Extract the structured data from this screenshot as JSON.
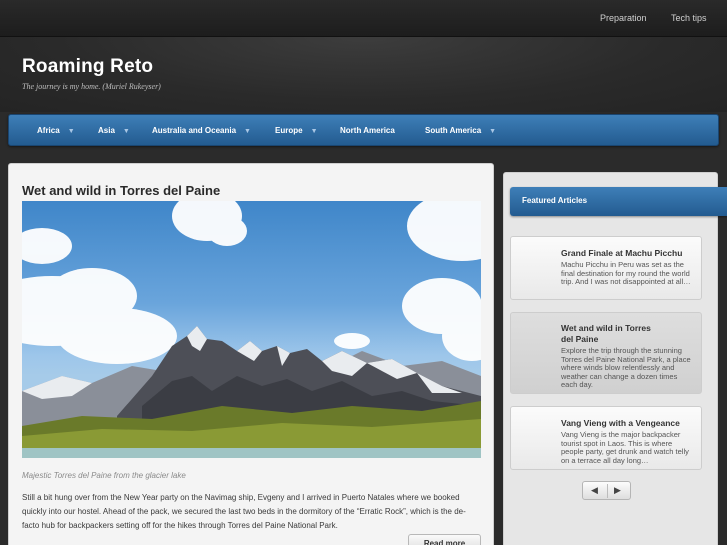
{
  "topnav": {
    "items": [
      {
        "label": "Preparation"
      },
      {
        "label": "Tech tips"
      }
    ]
  },
  "site": {
    "title": "Roaming Reto",
    "tagline": "The journey is my home. (Muriel Rukeyser)"
  },
  "mainnav": {
    "items": [
      {
        "label": "Africa",
        "has_dropdown": true
      },
      {
        "label": "Asia",
        "has_dropdown": true
      },
      {
        "label": "Australia and Oceania",
        "has_dropdown": true
      },
      {
        "label": "Europe",
        "has_dropdown": true
      },
      {
        "label": "North America",
        "has_dropdown": false
      },
      {
        "label": "South America",
        "has_dropdown": true
      }
    ],
    "chevron_icon": "chevron-down-icon"
  },
  "post": {
    "title": "Wet and wild in Torres del Paine",
    "caption": "Majestic Torres del Paine from the glacier lake",
    "excerpt": "Still a bit hung over from the New Year party on the Navimag ship, Evgeny and I arrived in Puerto Natales where we booked quickly into our hostel. Ahead of the pack, we secured the last two beds in the dormitory of the “Erratic Rock”, which is the de-facto hub for backpackers setting off for the hikes through Torres del Paine National Park.",
    "read_more": "Read more"
  },
  "sidebar": {
    "title": "Featured Articles",
    "articles": [
      {
        "title": "Grand Finale at Machu Picchu",
        "text": "Machu Picchu in Peru was set as the final destination for my round the world trip. And I was not disappointed at all…",
        "active": false
      },
      {
        "title": "Wet and wild in Torres del Paine",
        "text": "Explore the trip through the stunning Torres del Paine National Park, a place where winds blow relentlessly and weather can change a dozen times each day.",
        "active": true
      },
      {
        "title": "Vang Vieng with a Vengeance",
        "text": "Vang Vieng is the major backpacker tourist spot in Laos. This is where people party, get drunk and watch telly on a terrace all day long…",
        "active": false
      }
    ],
    "pager": {
      "prev_icon": "triangle-left-icon",
      "next_icon": "triangle-right-icon"
    }
  },
  "colors": {
    "nav_blue": "#2f6ca6",
    "background": "#2b2b2b",
    "panel": "#f4f4f4"
  }
}
